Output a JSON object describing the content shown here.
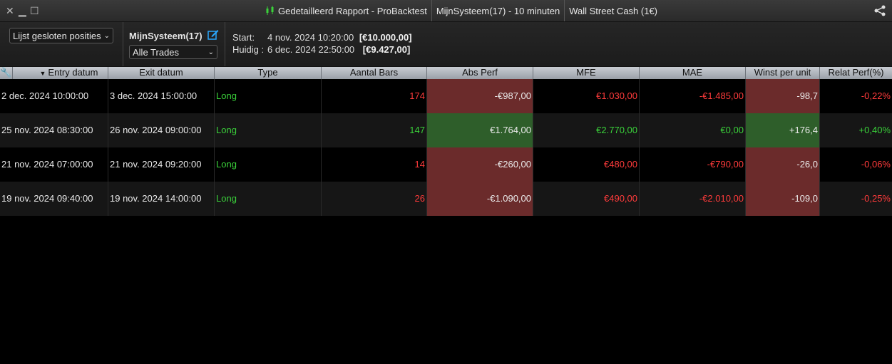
{
  "window": {
    "title_main": "Gedetailleerd Rapport - ProBacktest",
    "title_system": "MijnSysteem(17) - 10 minuten",
    "title_instrument": "Wall Street Cash (1€)"
  },
  "toolbar": {
    "list_select": "Lijst gesloten posities",
    "system_name": "MijnSysteem(17)",
    "trades_select": "Alle Trades",
    "start_label": "Start:",
    "start_date": "4 nov. 2024 10:20:00",
    "start_value": "[€10.000,00]",
    "current_label": "Huidig :",
    "current_date": "6 dec. 2024 22:50:00",
    "current_value": "[€9.427,00]"
  },
  "table": {
    "columns": [
      "Entry datum",
      "Exit datum",
      "Type",
      "Aantal Bars",
      "Abs Perf",
      "MFE",
      "MAE",
      "Winst per unit",
      "Relat Perf(%)"
    ],
    "rows": [
      {
        "entry": "2 dec. 2024 10:00:00",
        "exit": "3 dec. 2024 15:00:00",
        "type": "Long",
        "bars": "174",
        "abs": "-€987,00",
        "mfe": "€1.030,00",
        "mae": "-€1.485,00",
        "wpu": "-98,7",
        "rel": "-0,22%"
      },
      {
        "entry": "25 nov. 2024 08:30:00",
        "exit": "26 nov. 2024 09:00:00",
        "type": "Long",
        "bars": "147",
        "abs": "€1.764,00",
        "mfe": "€2.770,00",
        "mae": "€0,00",
        "wpu": "+176,4",
        "rel": "+0,40%"
      },
      {
        "entry": "21 nov. 2024 07:00:00",
        "exit": "21 nov. 2024 09:20:00",
        "type": "Long",
        "bars": "14",
        "abs": "-€260,00",
        "mfe": "€480,00",
        "mae": "-€790,00",
        "wpu": "-26,0",
        "rel": "-0,06%"
      },
      {
        "entry": "19 nov. 2024 09:40:00",
        "exit": "19 nov. 2024 14:00:00",
        "type": "Long",
        "bars": "26",
        "abs": "-€1.090,00",
        "mfe": "€490,00",
        "mae": "-€2.010,00",
        "wpu": "-109,0",
        "rel": "-0,25%"
      }
    ]
  },
  "colors": {
    "negative": "#ff3b3b",
    "positive": "#3ad13a",
    "loss_bg": "#6b2b2b",
    "gain_bg": "#2e5e2a"
  }
}
